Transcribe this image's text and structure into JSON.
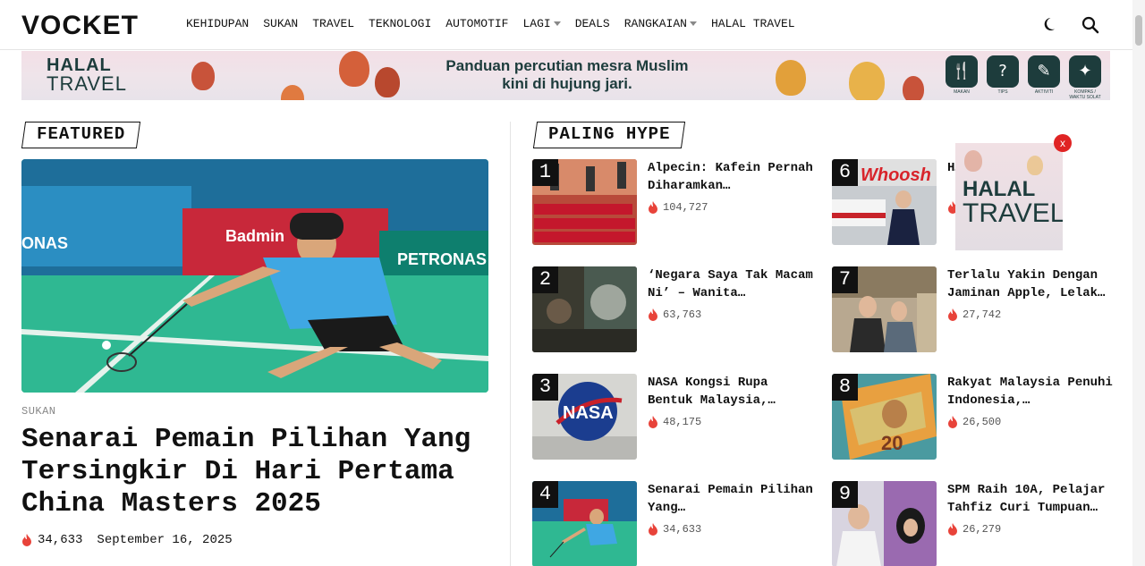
{
  "header": {
    "logo": "VOCKET",
    "nav": [
      {
        "label": "KEHIDUPAN",
        "dropdown": false
      },
      {
        "label": "SUKAN",
        "dropdown": false
      },
      {
        "label": "TRAVEL",
        "dropdown": false
      },
      {
        "label": "TEKNOLOGI",
        "dropdown": false
      },
      {
        "label": "AUTOMOTIF",
        "dropdown": false
      },
      {
        "label": "LAGI",
        "dropdown": true
      },
      {
        "label": "DEALS",
        "dropdown": false
      },
      {
        "label": "RANGKAIAN",
        "dropdown": true
      },
      {
        "label": "HALAL TRAVEL",
        "dropdown": false
      }
    ],
    "icons": {
      "theme": "moon-icon",
      "search": "search-icon"
    }
  },
  "banner": {
    "brand_line1": "HALAL",
    "brand_line2": "TRAVEL",
    "tagline_line1": "Panduan percutian mesra Muslim",
    "tagline_line2": "kini di hujung jari.",
    "features": [
      {
        "icon": "utensils-icon",
        "label": "MAKAN"
      },
      {
        "icon": "tips-icon",
        "label": "TIPS"
      },
      {
        "icon": "activity-icon",
        "label": "AKTIVITI"
      },
      {
        "icon": "compass-icon",
        "label": "KOMPAS / WAKTU SOLAT"
      }
    ]
  },
  "featured": {
    "heading": "FEATURED",
    "category": "SUKAN",
    "title": "Senarai Pemain Pilihan Yang Tersingkir Di Hari Pertama China Masters 2025",
    "views": "34,633",
    "date": "September 16, 2025"
  },
  "hype": {
    "heading": "PALING HYPE",
    "items": [
      {
        "rank": "1",
        "title": "Alpecin: Kafein Pernah Diharamkan…",
        "views": "104,727"
      },
      {
        "rank": "2",
        "title": "‘Negara Saya Tak Macam Ni’ – Wanita…",
        "views": "63,763"
      },
      {
        "rank": "3",
        "title": "NASA Kongsi Rupa Bentuk Malaysia,…",
        "views": "48,175"
      },
      {
        "rank": "4",
        "title": "Senarai Pemain Pilihan Yang…",
        "views": "34,633"
      },
      {
        "rank": "6",
        "title": "H…             pi L…           akin…",
        "views": ""
      },
      {
        "rank": "7",
        "title": "Terlalu Yakin Dengan Jaminan Apple, Lelak…",
        "views": "27,742"
      },
      {
        "rank": "8",
        "title": "Rakyat Malaysia Penuhi Indonesia,…",
        "views": "26,500"
      },
      {
        "rank": "9",
        "title": "SPM Raih 10A, Pelajar Tahfiz Curi Tumpuan…",
        "views": "26,279"
      }
    ]
  },
  "popup_ad": {
    "brand_line1": "HALAL",
    "brand_line2": "TRAVEL",
    "close_label": "x"
  },
  "colors": {
    "brand_dark": "#1d3c3c",
    "flame": "#e8433a",
    "close": "#e02424"
  }
}
